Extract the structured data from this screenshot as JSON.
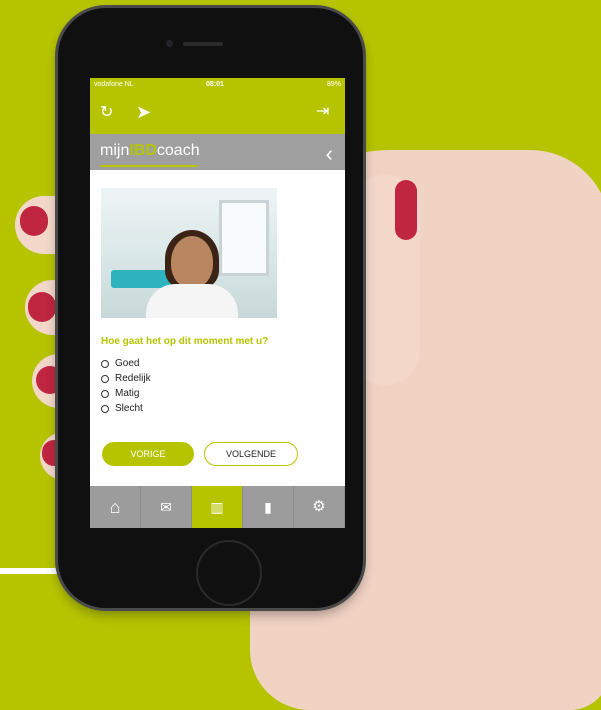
{
  "status_bar": {
    "carrier": "vodafone NL",
    "time": "08:01",
    "battery": "89%"
  },
  "app": {
    "logo_prefix": "mijn",
    "logo_brand": "IBD",
    "logo_suffix": "coach"
  },
  "question": {
    "text": "Hoe gaat het op dit moment met u?",
    "options": [
      "Goed",
      "Redelijk",
      "Matig",
      "Slecht"
    ]
  },
  "buttons": {
    "previous": "VORIGE",
    "next": "VOLGENDE"
  },
  "icons": {
    "refresh": "refresh-icon",
    "back": "back-arrow-icon",
    "logout": "logout-icon",
    "chevron": "chevron-left-icon",
    "home": "home-icon",
    "mail": "mail-icon",
    "library": "library-icon",
    "stats": "bar-chart-icon",
    "settings": "settings-icon"
  },
  "colors": {
    "accent": "#b6c400",
    "background": "#b6c400",
    "nav": "#9c9c9c"
  }
}
